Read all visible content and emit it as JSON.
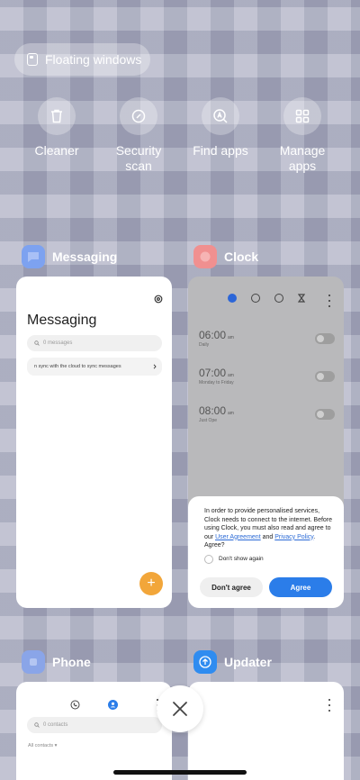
{
  "floating_windows": {
    "label": "Floating windows"
  },
  "quick_actions": [
    {
      "label": "Cleaner",
      "icon": "trash-icon"
    },
    {
      "label": "Security\nscan",
      "icon": "security-scan-icon"
    },
    {
      "label": "Find apps",
      "icon": "find-apps-icon"
    },
    {
      "label": "Manage\napps",
      "icon": "manage-apps-icon"
    }
  ],
  "apps": {
    "messaging": {
      "name": "Messaging",
      "title": "Messaging",
      "search_placeholder": "0 messages",
      "sync_text": "n sync with the cloud to sync messages",
      "fab": "+",
      "icon_color": "#7da2f0"
    },
    "clock": {
      "name": "Clock",
      "icon_color": "#f09090",
      "alarms": [
        {
          "time": "06:00",
          "ampm": "am",
          "repeat": "Daily"
        },
        {
          "time": "07:00",
          "ampm": "am",
          "repeat": "Monday to Friday"
        },
        {
          "time": "08:00",
          "ampm": "am",
          "repeat": "Just Ope"
        }
      ],
      "dialog": {
        "text_before_link1": "In order to provide personalised services, Clock needs to connect to the internet. Before using Clock, you must also read and agree to our ",
        "link1": "User Agreement",
        "text_between": " and ",
        "link2": "Privacy Policy",
        "text_after": ". Agree?",
        "checkbox_label": "Don't show again",
        "disagree_label": "Don't agree",
        "agree_label": "Agree"
      }
    },
    "phone": {
      "name": "Phone",
      "search_placeholder": "0 contacts",
      "section_label": "All contacts",
      "icon_color": "#8aa5e8"
    },
    "updater": {
      "name": "Updater",
      "icon_color": "#2f8cf0"
    }
  },
  "colors": {
    "accent": "#2b7de9",
    "fab": "#f2a63a"
  }
}
